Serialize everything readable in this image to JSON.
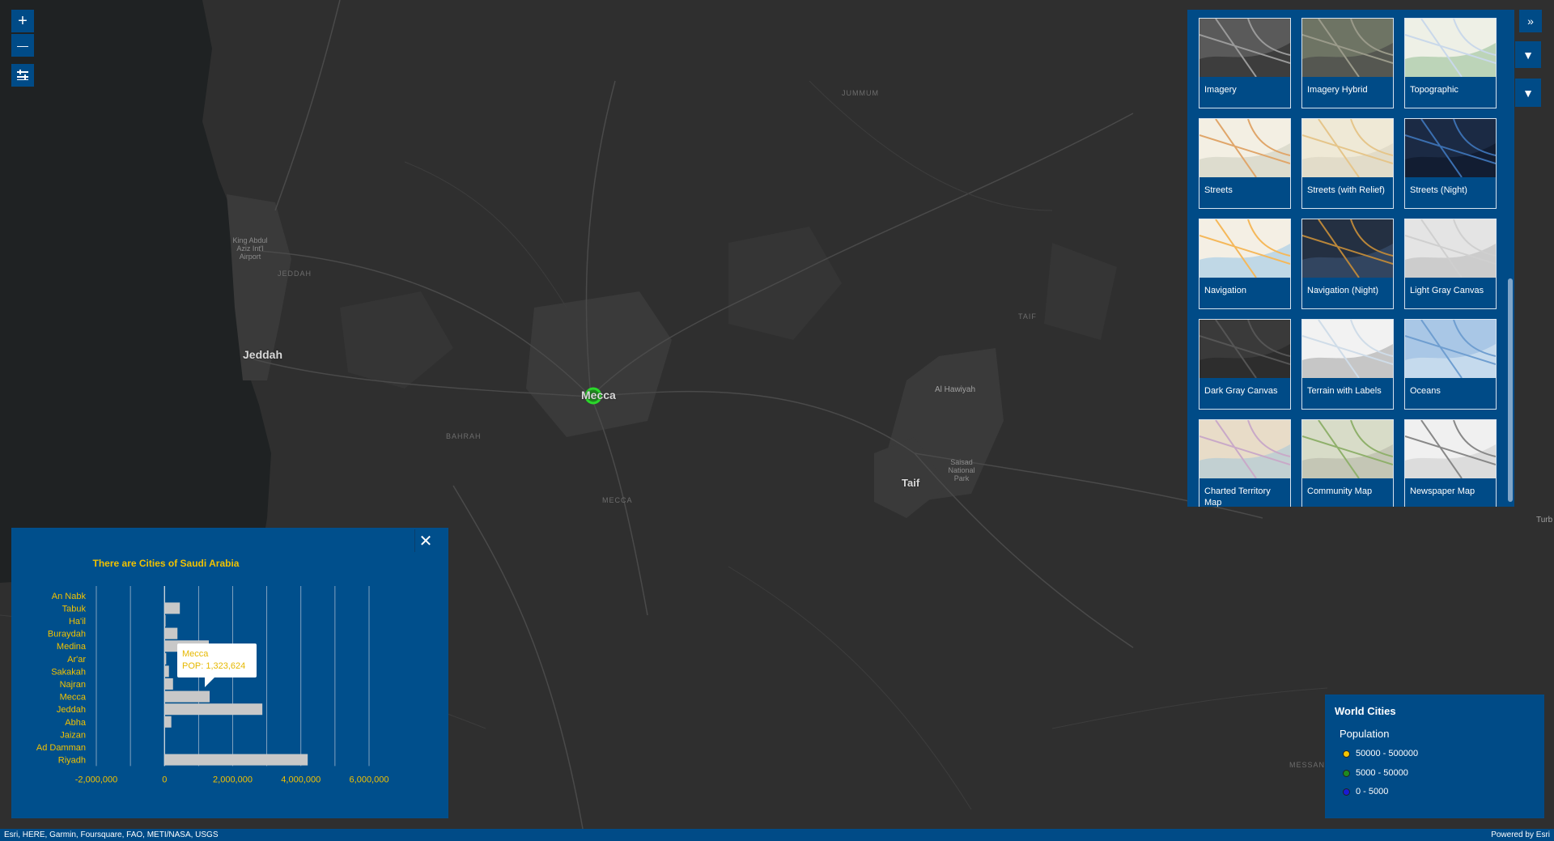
{
  "map": {
    "labels": {
      "jeddah": "Jeddah",
      "mecca": "Mecca",
      "taif": "Taif",
      "airport": "King Abdul Aziz Int'l Airport",
      "jeddah_district": "JEDDAH",
      "jummum": "JUMMUM",
      "taif_district": "TAIF",
      "bahrah": "BAHRAH",
      "mecca_district": "MECCA",
      "messan": "MESSAN",
      "al_hawiyah": "Al Hawiyah",
      "saisad_park": "Saisad National Park",
      "turb": "Turb"
    }
  },
  "zoom": {
    "in": "+",
    "out": "—"
  },
  "basemaps": [
    {
      "label": "Imagery",
      "icon": "imagery-thumbnail"
    },
    {
      "label": "Imagery Hybrid",
      "icon": "imagery-hybrid-thumbnail"
    },
    {
      "label": "Topographic",
      "icon": "topographic-thumbnail"
    },
    {
      "label": "Streets",
      "icon": "streets-thumbnail"
    },
    {
      "label": "Streets (with Relief)",
      "icon": "streets-relief-thumbnail"
    },
    {
      "label": "Streets (Night)",
      "icon": "streets-night-thumbnail"
    },
    {
      "label": "Navigation",
      "icon": "navigation-thumbnail"
    },
    {
      "label": "Navigation (Night)",
      "icon": "navigation-night-thumbnail"
    },
    {
      "label": "Light Gray Canvas",
      "icon": "light-gray-canvas-thumbnail"
    },
    {
      "label": "Dark Gray Canvas",
      "icon": "dark-gray-canvas-thumbnail"
    },
    {
      "label": "Terrain with Labels",
      "icon": "terrain-thumbnail"
    },
    {
      "label": "Oceans",
      "icon": "oceans-thumbnail"
    },
    {
      "label": "Charted Territory Map",
      "icon": "charted-territory-thumbnail"
    },
    {
      "label": "Community Map",
      "icon": "community-map-thumbnail"
    },
    {
      "label": "Newspaper Map",
      "icon": "newspaper-map-thumbnail"
    }
  ],
  "chart_data": {
    "type": "bar",
    "orientation": "horizontal",
    "title": "There are Cities of Saudi Arabia",
    "categories": [
      "An Nabk",
      "Tabuk",
      "Ha'il",
      "Buraydah",
      "Medina",
      "Ar'ar",
      "Sakakah",
      "Najran",
      "Mecca",
      "Jeddah",
      "Abha",
      "Jaizan",
      "Ad Damman",
      "Riyadh"
    ],
    "values": [
      0,
      450000,
      30000,
      380000,
      1300000,
      50000,
      130000,
      250000,
      1323624,
      2870000,
      200000,
      0,
      0,
      4200000
    ],
    "xlim": [
      -2000000,
      6000000
    ],
    "xticks": [
      "-2,000,000",
      "0",
      "2,000,000",
      "4,000,000",
      "6,000,000"
    ],
    "grid": true,
    "bar_color": "#c8c8c8",
    "label_color": "#f2c200",
    "tooltip": {
      "name": "Mecca",
      "text": "POP: 1,323,624"
    }
  },
  "legend": {
    "title": "World Cities",
    "subtitle": "Population",
    "items": [
      {
        "label": "50000 - 500000",
        "color": "#f5c400"
      },
      {
        "label": "5000 - 50000",
        "color": "#1f8a1f"
      },
      {
        "label": "0 - 5000",
        "color": "#1a1ad6"
      }
    ]
  },
  "attribution": {
    "sources": "Esri, HERE, Garmin, Foursquare, FAO, METI/NASA, USGS",
    "powered": "Powered by Esri"
  }
}
